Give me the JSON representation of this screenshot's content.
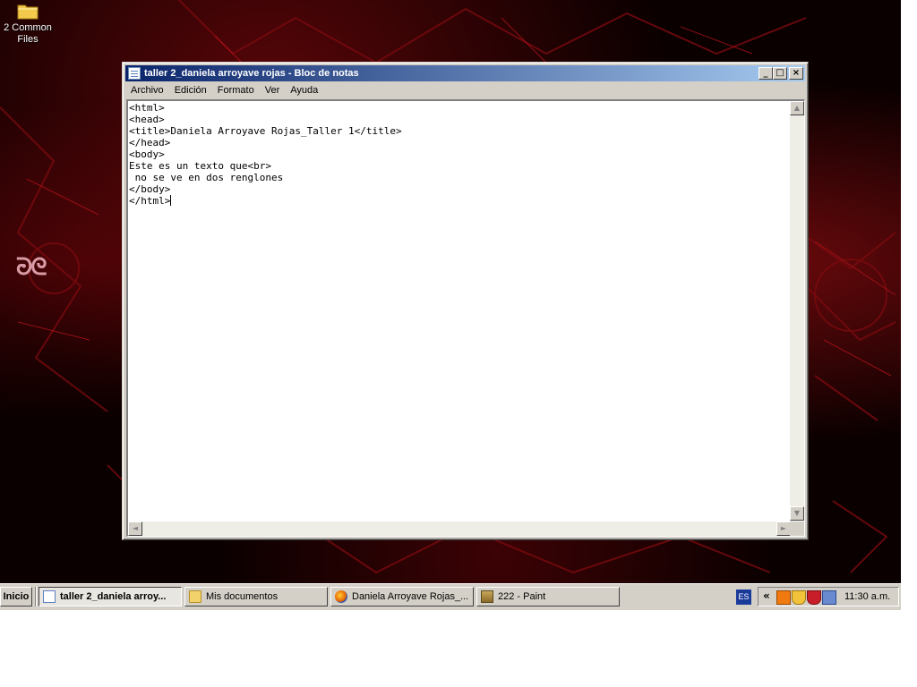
{
  "desktop": {
    "icons": [
      {
        "label": "C2 Common Files",
        "label_line1": "2 Common",
        "label_line2": "Files"
      }
    ]
  },
  "window": {
    "title": "taller 2_daniela arroyave rojas - Bloc de notas",
    "controls": {
      "minimize": "_",
      "maximize": "□",
      "close": "×"
    },
    "menu": [
      "Archivo",
      "Edición",
      "Formato",
      "Ver",
      "Ayuda"
    ],
    "content": "<html>\n<head>\n<title>Daniela Arroyave Rojas_Taller 1</title>\n</head>\n<body>\nEste es un texto que<br>\n no se ve en dos renglones\n</body>\n</html>",
    "scroll_glyphs": {
      "up": "▲",
      "down": "▼",
      "left": "◄",
      "right": "►"
    }
  },
  "taskbar": {
    "start_label": "Inicio",
    "tasks": [
      {
        "label": "taller 2_daniela arroy...",
        "icon": "notepad-icon",
        "active": true
      },
      {
        "label": "Mis documentos",
        "icon": "folder-icon",
        "active": false
      },
      {
        "label": "Daniela Arroyave Rojas_...",
        "icon": "firefox-icon",
        "active": false
      },
      {
        "label": "222 - Paint",
        "icon": "paint-icon",
        "active": false
      }
    ],
    "language": "ES",
    "tray_expand": "«",
    "tray_icons": [
      "avast-icon",
      "shield-icon",
      "security-icon",
      "network-icon"
    ],
    "clock": "11:30 a.m."
  },
  "colors": {
    "titlebar_start": "#0a246a",
    "titlebar_end": "#a6caf0",
    "chrome": "#d4d0c8",
    "desktop_red": "#aa0f14"
  }
}
